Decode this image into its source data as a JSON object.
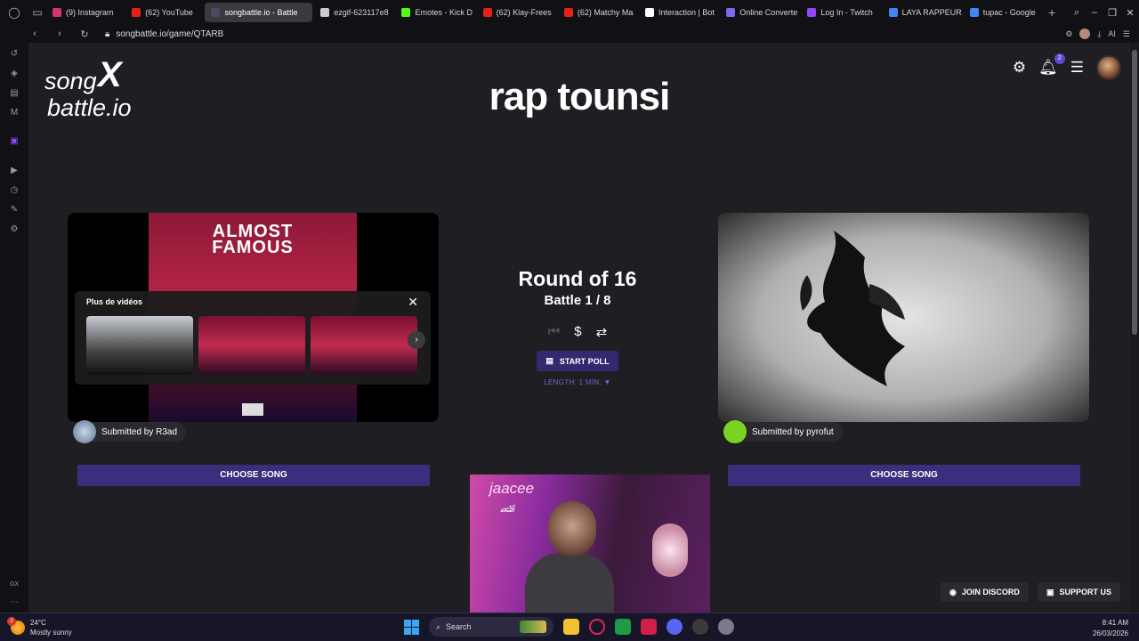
{
  "browser": {
    "tabs": [
      {
        "label": "(9) Instagram",
        "favicon_color": "#d6336c",
        "icon": "instagram-icon",
        "active": false
      },
      {
        "label": "(62) YouTube",
        "favicon_color": "#e62117",
        "icon": "youtube-icon",
        "active": false
      },
      {
        "label": "songbattle.io - Battle",
        "favicon_color": "#4a4a60",
        "icon": "songbattle-icon",
        "active": true
      },
      {
        "label": "ezgif-623117e8",
        "favicon_color": "#cccccc",
        "icon": "file-icon",
        "active": false
      },
      {
        "label": "Emotes - Kick D",
        "favicon_color": "#53fc18",
        "icon": "kick-icon",
        "active": false
      },
      {
        "label": "(62) Klay-Frees",
        "favicon_color": "#e62117",
        "icon": "youtube-icon",
        "active": false
      },
      {
        "label": "(62) Matchy Ma",
        "favicon_color": "#e62117",
        "icon": "youtube-icon",
        "active": false
      },
      {
        "label": "Interaction | Bot",
        "favicon_color": "#ffffff",
        "icon": "bot-icon",
        "active": false
      },
      {
        "label": "Online Converte",
        "favicon_color": "#7b68ee",
        "icon": "converter-icon",
        "active": false
      },
      {
        "label": "Log In - Twitch",
        "favicon_color": "#9146ff",
        "icon": "twitch-icon",
        "active": false
      },
      {
        "label": "LAYA RAPPEUR",
        "favicon_color": "#4285f4",
        "icon": "google-icon",
        "active": false
      },
      {
        "label": "tupac - Google",
        "favicon_color": "#4285f4",
        "icon": "google-icon",
        "active": false
      }
    ],
    "url": "songbattle.io/game/QTARB",
    "ai_label": "AI",
    "gx_label": "GX"
  },
  "header": {
    "logo_line1": "song",
    "logo_line2": "battle.io",
    "logo_x": "X",
    "title": "rap tounsi",
    "notif_count": "2"
  },
  "left": {
    "brand": "ALMOST\nFAMOUS",
    "more_videos": "Plus de vidéos",
    "submitted": "Submitted by R3ad",
    "choose": "CHOOSE SONG",
    "avatar_color": "#8aa6c8"
  },
  "right": {
    "submitted": "Submitted by pyrofut",
    "choose": "CHOOSE SONG",
    "avatar_color": "#7bd321"
  },
  "center": {
    "round": "Round of 16",
    "battle": "Battle 1 / 8",
    "start_poll": "START POLL",
    "length": "LENGTH: 1 MIN. ▼"
  },
  "webcam": {
    "name": "jaacee"
  },
  "floating": {
    "discord": "JOIN DISCORD",
    "support": "SUPPORT US"
  },
  "taskbar": {
    "temp": "24°C",
    "weather": "Mostly sunny",
    "search": "Search",
    "time": "8:41 AM",
    "date": "26/03/2026",
    "weather_badge": "2"
  },
  "colors": {
    "accent": "#3a2e7d",
    "background": "#1f1e23"
  }
}
